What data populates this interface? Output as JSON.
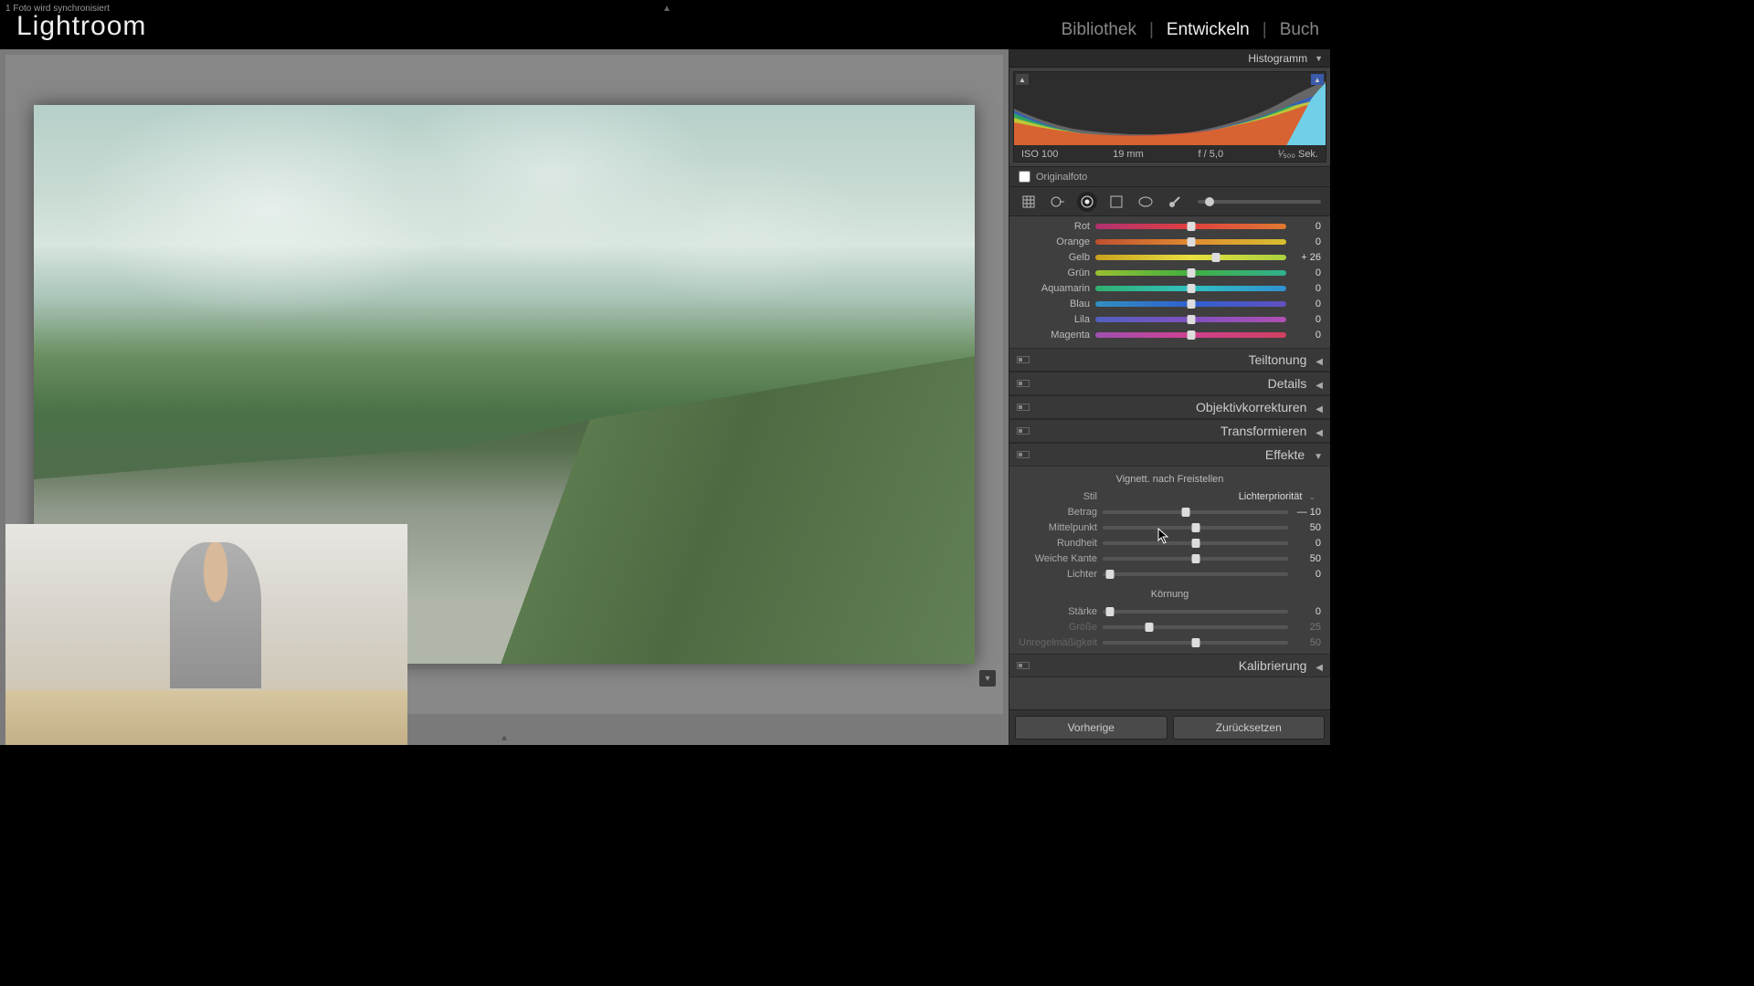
{
  "top": {
    "sync_status": "1 Foto wird synchronisiert",
    "app_title": "Lightroom",
    "modules": {
      "library": "Bibliothek",
      "develop": "Entwickeln",
      "book": "Buch"
    }
  },
  "histogram": {
    "title": "Histogramm",
    "iso": "ISO 100",
    "focal": "19 mm",
    "aperture": "f / 5,0",
    "shutter": "¹⁄₅₀₀ Sek.",
    "original_checkbox": "Originalfoto"
  },
  "color_sliders": [
    {
      "label": "Rot",
      "value": "0",
      "pos": 50,
      "gradient": "linear-gradient(to right,#b03070,#e04040,#e07a30)"
    },
    {
      "label": "Orange",
      "value": "0",
      "pos": 50,
      "gradient": "linear-gradient(to right,#c05030,#e08a30,#d8c030)"
    },
    {
      "label": "Gelb",
      "value": "+ 26",
      "pos": 63,
      "gradient": "linear-gradient(to right,#c9a020,#e8e040,#a8d040)"
    },
    {
      "label": "Grün",
      "value": "0",
      "pos": 50,
      "gradient": "linear-gradient(to right,#9ac030,#40b040,#30b090)"
    },
    {
      "label": "Aquamarin",
      "value": "0",
      "pos": 50,
      "gradient": "linear-gradient(to right,#30b070,#30c0c0,#3090d0)"
    },
    {
      "label": "Blau",
      "value": "0",
      "pos": 50,
      "gradient": "linear-gradient(to right,#3090c0,#3060d0,#6050c0)"
    },
    {
      "label": "Lila",
      "value": "0",
      "pos": 50,
      "gradient": "linear-gradient(to right,#5060c0,#8050c0,#b050b0)"
    },
    {
      "label": "Magenta",
      "value": "0",
      "pos": 50,
      "gradient": "linear-gradient(to right,#a050b0,#d04090,#d04060)"
    }
  ],
  "collapsed_panels": [
    "Teiltonung",
    "Details",
    "Objektivkorrekturen",
    "Transformieren"
  ],
  "effects": {
    "title": "Effekte",
    "vignette_header": "Vignett. nach Freistellen",
    "style_label": "Stil",
    "style_value": "Lichterpriorität",
    "rows": [
      {
        "label": "Betrag",
        "value": "— 10",
        "pos": 45,
        "dim": false
      },
      {
        "label": "Mittelpunkt",
        "value": "50",
        "pos": 50,
        "dim": false
      },
      {
        "label": "Rundheit",
        "value": "0",
        "pos": 50,
        "dim": false
      },
      {
        "label": "Weiche Kante",
        "value": "50",
        "pos": 50,
        "dim": false
      },
      {
        "label": "Lichter",
        "value": "0",
        "pos": 4,
        "dim": false
      }
    ],
    "grain_header": "Körnung",
    "grain_rows": [
      {
        "label": "Stärke",
        "value": "0",
        "pos": 4,
        "dim": false
      },
      {
        "label": "Größe",
        "value": "25",
        "pos": 25,
        "dim": true
      },
      {
        "label": "Unregelmäßigkeit",
        "value": "50",
        "pos": 50,
        "dim": true
      }
    ]
  },
  "calibration_title": "Kalibrierung",
  "footer": {
    "previous": "Vorherige",
    "reset": "Zurücksetzen"
  }
}
